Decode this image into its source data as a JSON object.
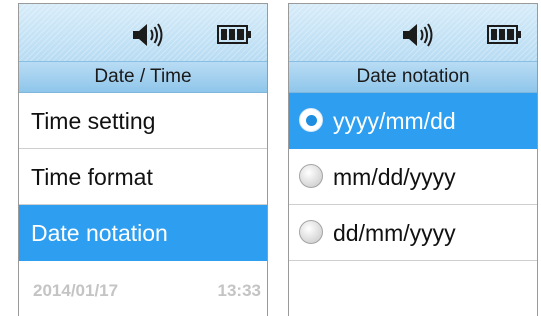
{
  "left_screen": {
    "status_icons": [
      "speaker-volume-icon",
      "battery-full-icon"
    ],
    "title": "Date / Time",
    "menu": [
      {
        "label": "Time setting",
        "selected": false
      },
      {
        "label": "Time format",
        "selected": false
      },
      {
        "label": "Date notation",
        "selected": true
      }
    ],
    "footer": {
      "date": "2014/01/17",
      "time": "13:33"
    }
  },
  "right_screen": {
    "status_icons": [
      "speaker-volume-icon",
      "battery-full-icon"
    ],
    "title": "Date notation",
    "options": [
      {
        "label": "yyyy/mm/dd",
        "selected": true
      },
      {
        "label": "mm/dd/yyyy",
        "selected": false
      },
      {
        "label": "dd/mm/yyyy",
        "selected": false
      }
    ]
  },
  "colors": {
    "accent": "#2e9ff0",
    "title_bar": "#a7d2f0",
    "status_bar": "#c9e5f7",
    "footer_text": "#c4c4c4"
  }
}
